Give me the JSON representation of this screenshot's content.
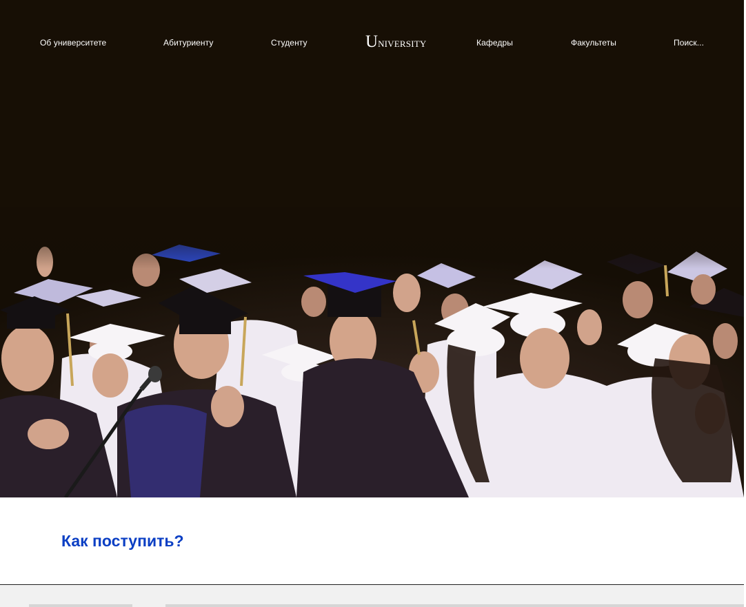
{
  "nav": {
    "items": [
      {
        "label": "Об  университете"
      },
      {
        "label": "Абитуриенту"
      },
      {
        "label": "Студенту"
      },
      {
        "label": "Кафедры"
      },
      {
        "label": "Факультеты"
      },
      {
        "label": "Поиск..."
      }
    ],
    "logo": {
      "initial": "U",
      "rest": "NIVERSITY"
    }
  },
  "hero": {
    "image_description_icon": "graduation-photo"
  },
  "main": {
    "section_title": "Как поступить?"
  },
  "colors": {
    "hero_background": "#170f05",
    "accent_link": "#0b3fc4",
    "gown_white": "#f4f1f4",
    "gown_dark": "#2a1f2a",
    "cap_blue": "#3a3ad8"
  }
}
